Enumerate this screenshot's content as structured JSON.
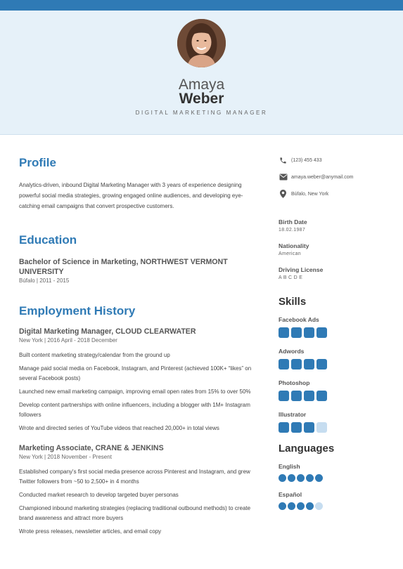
{
  "header": {
    "first_name": "Amaya",
    "last_name": "Weber",
    "job_title": "DIGITAL MARKETING MANAGER"
  },
  "profile": {
    "title": "Profile",
    "text": "Analytics-driven, inbound Digital Marketing Manager with 3 years of experience designing powerful social media strategies, growing engaged online audiences, and developing eye-catching email campaigns that convert prospective customers."
  },
  "education": {
    "title": "Education",
    "degree": "Bachelor of Science in Marketing, NORTHWEST VERMONT UNIVERSITY",
    "sub": "Búfalo | 2011 - 2015"
  },
  "employment": {
    "title": "Employment History",
    "jobs": [
      {
        "title": "Digital Marketing Manager, CLOUD CLEARWATER",
        "sub": "New York | 2016 April - 2018 December",
        "bullets": [
          "Built content marketing strategy/calendar from the ground up",
          "Manage paid social media on Facebook, Instagram, and Pinterest (achieved 100K+ “likes” on several Facebook posts)",
          "Launched new email marketing campaign, improving email open rates from 15% to over 50%",
          "Develop content partnerships with online influencers, including a blogger with 1M+ Instagram followers",
          "Wrote and directed series of YouTube videos that reached 20,000+ in total views"
        ]
      },
      {
        "title": "Marketing Associate, CRANE & JENKINS",
        "sub": "New York | 2018 November - Present",
        "bullets": [
          "Established company's first social media presence across Pinterest and Instagram, and grew Twitter followers from ~50 to 2,500+ in 4 months",
          "Conducted market research to develop targeted buyer personas",
          "Championed inbound marketing strategies (replacing traditional outbound methods) to create brand awareness and attract more buyers",
          "Wrote press releases, newsletter articles, and email copy"
        ]
      }
    ]
  },
  "contact": {
    "phone": "(123) 455 433",
    "email": "amaya.weber@anymail.com",
    "location": "Búfalo, New York"
  },
  "details": {
    "birth_label": "Birth Date",
    "birth_value": "18.02.1987",
    "nationality_label": "Nationality",
    "nationality_value": "American",
    "license_label": "Driving License",
    "license_value": "A B C D E"
  },
  "skills": {
    "title": "Skills",
    "items": [
      {
        "name": "Facebook Ads",
        "level": 4,
        "max": 4
      },
      {
        "name": "Adwords",
        "level": 4,
        "max": 4
      },
      {
        "name": "Photoshop",
        "level": 4,
        "max": 4
      },
      {
        "name": "Illustrator",
        "level": 3,
        "max": 4
      }
    ]
  },
  "languages": {
    "title": "Languages",
    "items": [
      {
        "name": "English",
        "level": 5,
        "max": 5
      },
      {
        "name": "Español",
        "level": 4,
        "max": 5
      }
    ]
  },
  "colors": {
    "accent": "#2f7ab5",
    "accent_light": "#c6ddf0",
    "header_bg": "#e6f1f9"
  },
  "icons": {
    "phone": "phone-icon",
    "email": "envelope-icon",
    "location": "map-pin-icon"
  }
}
